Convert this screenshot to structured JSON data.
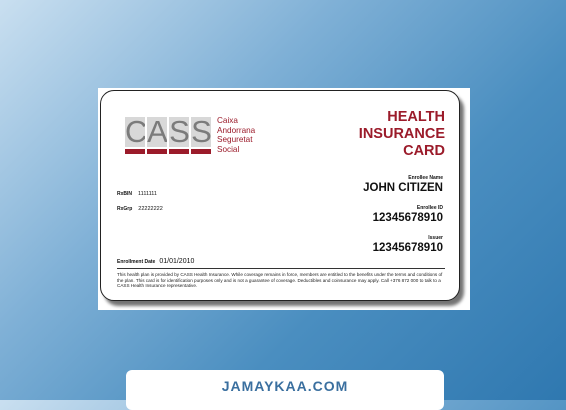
{
  "card": {
    "logo": {
      "letters": [
        "C",
        "A",
        "S",
        "S"
      ],
      "text_lines": [
        "Caixa",
        "Andorrana",
        "Seguretat",
        "Social"
      ]
    },
    "title_lines": [
      "HEALTH",
      "INSURANCE",
      "CARD"
    ],
    "rxbin": {
      "label": "RxBIN",
      "value": "1111111"
    },
    "rxgrp": {
      "label": "RxGrp",
      "value": "22222222"
    },
    "enrollment": {
      "label": "Enrollment Date",
      "value": "01/01/2010"
    },
    "enrollee_name": {
      "label": "Enrollee Name",
      "value": "JOHN CITIZEN"
    },
    "enrollee_id": {
      "label": "Enrollee ID",
      "value": "12345678910"
    },
    "issuer": {
      "label": "Issuer",
      "value": "12345678910"
    },
    "fine_print": "This health plan is provided by CASS Health Insurance. While coverage remains in force, members are entitled to the benefits under the terms and conditions of the plan. This card is for identification purposes only and is not a guarantee of coverage. Deductibles and coinsurance may apply. Call +376 872 000 to talk to a CASS Health Insurance representative."
  },
  "banner": {
    "text": "JAMAYKAA.COM"
  },
  "colors": {
    "brand_red": "#9b1b2a",
    "banner_text": "#3a6f9f"
  }
}
